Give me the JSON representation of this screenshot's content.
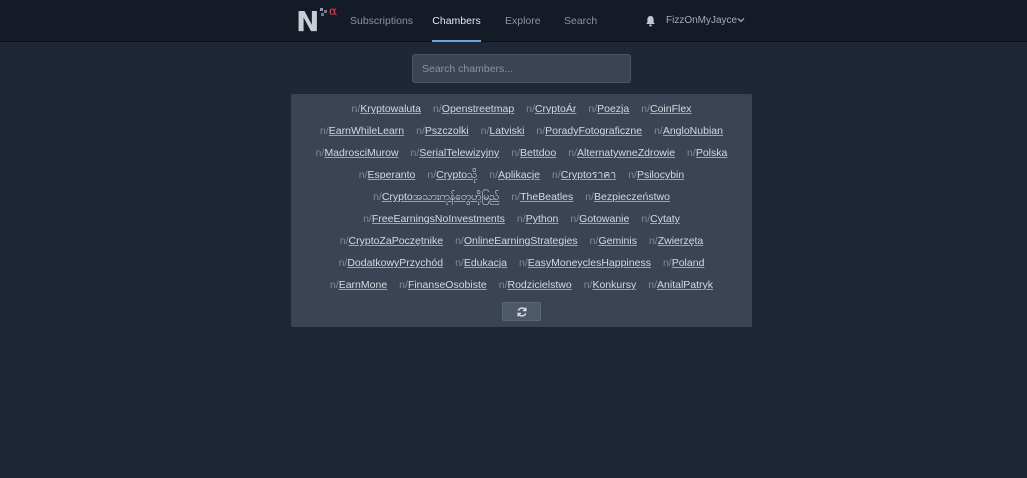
{
  "header": {
    "logo": {
      "letter": "N",
      "badge": "α"
    },
    "nav": [
      {
        "label": "Subscriptions",
        "active": false
      },
      {
        "label": "Chambers",
        "active": true
      },
      {
        "label": "Explore",
        "active": false
      },
      {
        "label": "Search",
        "active": false
      }
    ],
    "user": {
      "name": "FizzOnMyJayce"
    }
  },
  "search": {
    "placeholder": "Search chambers..."
  },
  "chambers": {
    "prefix": "n/",
    "rows": [
      [
        "Kryptowaluta",
        "Openstreetmap",
        "CryptoÁr",
        "Poezja",
        "CoinFlex"
      ],
      [
        "EarnWhileLearn",
        "Pszczolki",
        "Latviski",
        "PoradyFotograficzne",
        "AngloNubian"
      ],
      [
        "MadrosciMurow",
        "SerialTelewizyjny",
        "Bettdoo",
        "AlternatywneZdrowie",
        "Polska"
      ],
      [
        "Esperanto",
        "Cryptoသို",
        "Aplikacje",
        "Cryptoราคา",
        "Psilocybin"
      ],
      [
        "Cryptoအသားကုန်တွေဟိုမြည်",
        "TheBeatles",
        "Bezpieczeństwo"
      ],
      [
        "FreeEarningsNoInvestments",
        "Python",
        "Gotowanie",
        "Cytaty"
      ],
      [
        "CryptoZaPoczętnike",
        "OnlineEarningStrategies",
        "Geminis",
        "Zwierzęta"
      ],
      [
        "DodatkowyPrzychód",
        "Edukacja",
        "EasyMoneyclesHappiness",
        "Poland"
      ],
      [
        "EarnMone",
        "FinanseOsobiste",
        "Rodzicielstwo",
        "Konkursy",
        "AnitalPatryk"
      ]
    ]
  },
  "colors": {
    "background": "#1f2736",
    "topbar": "#141b27",
    "panel": "#3a4454",
    "accent": "#6ea8d8",
    "logo_badge": "#e0444e"
  },
  "icons": {
    "bell": "bell-icon",
    "chevron": "chevron-down-icon",
    "refresh": "refresh-icon"
  }
}
